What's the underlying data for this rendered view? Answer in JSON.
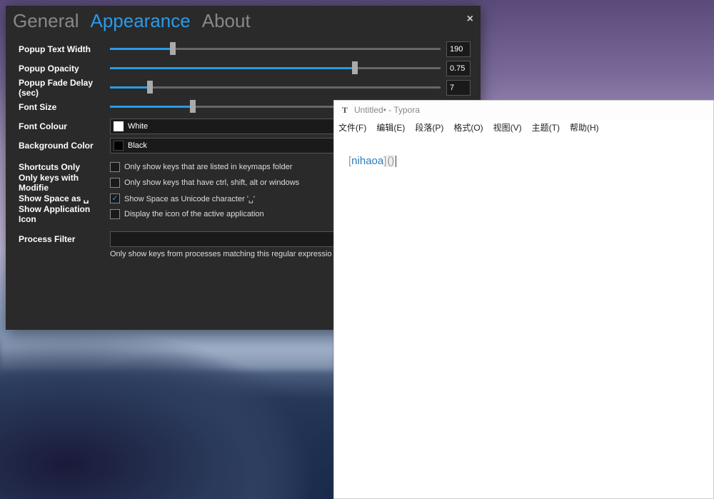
{
  "settings": {
    "tabs": {
      "general": "General",
      "appearance": "Appearance",
      "about": "About"
    },
    "close": "×",
    "rows": {
      "popup_text_width": {
        "label": "Popup Text Width",
        "value": "190",
        "fill_pct": 19
      },
      "popup_opacity": {
        "label": "Popup Opacity",
        "value": "0.75",
        "fill_pct": 74
      },
      "popup_fade_delay": {
        "label": "Popup Fade Delay (sec)",
        "value": "7",
        "fill_pct": 12
      },
      "font_size": {
        "label": "Font Size",
        "value": "",
        "fill_pct": 25
      },
      "font_colour": {
        "label": "Font Colour",
        "value": "White"
      },
      "background_color": {
        "label": "Background Color",
        "value": "Black"
      },
      "shortcuts_only": {
        "label": "Shortcuts Only",
        "desc": "Only show keys that are listed in keymaps folder",
        "checked": false
      },
      "only_modifier": {
        "label": "Only keys with Modifie",
        "desc": "Only show keys that have ctrl, shift, alt or windows",
        "checked": false
      },
      "show_space": {
        "label": "Show Space as ␣",
        "desc": "Show Space as Unicode character '␣'",
        "checked": true
      },
      "show_app_icon": {
        "label": "Show Application Icon",
        "desc": "Display the icon of the active application",
        "checked": false
      },
      "process_filter": {
        "label": "Process Filter",
        "help": "Only show keys from processes matching this regular expressio"
      }
    }
  },
  "typora": {
    "title": "Untitled• - Typora",
    "title_icon": "T",
    "menu": {
      "file": "文件(F)",
      "edit": "编辑(E)",
      "paragraph": "段落(P)",
      "format": "格式(O)",
      "view": "视图(V)",
      "theme": "主题(T)",
      "help": "帮助(H)"
    },
    "content": {
      "bracket_open": "[",
      "link_text": "nihaoa",
      "bracket_close": "]",
      "paren": "()"
    }
  }
}
